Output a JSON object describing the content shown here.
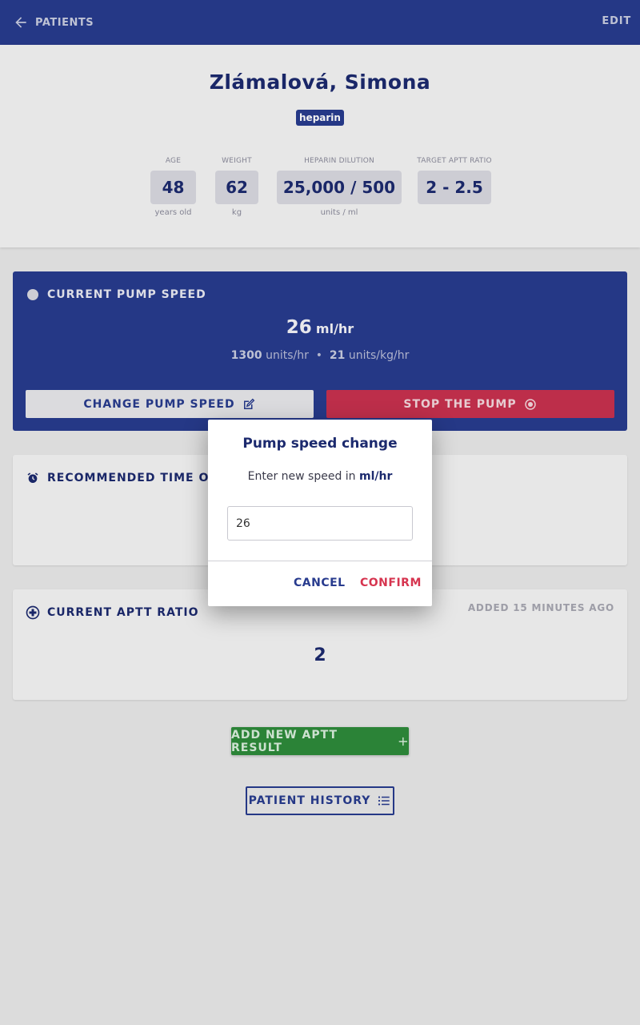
{
  "topbar": {
    "back_label": "PATIENTS",
    "edit_label": "EDIT"
  },
  "patient": {
    "name": "Zlámalová, Simona",
    "tag": "heparin",
    "stats": [
      {
        "label": "AGE",
        "value": "48",
        "unit": "years old"
      },
      {
        "label": "WEIGHT",
        "value": "62",
        "unit": "kg"
      },
      {
        "label": "HEPARIN DILUTION",
        "value": "25,000 / 500",
        "unit": "units / ml"
      },
      {
        "label": "TARGET APTT RATIO",
        "value": "2 - 2.5",
        "unit": ""
      }
    ]
  },
  "pump": {
    "title": "CURRENT PUMP SPEED",
    "speed": "26",
    "speed_unit": "ml/hr",
    "units_hr_value": "1300",
    "units_hr_label": "units/hr",
    "separator": "•",
    "units_kg_hr_value": "21",
    "units_kg_hr_label": "units/kg/hr",
    "change_label": "CHANGE PUMP SPEED",
    "stop_label": "STOP THE PUMP"
  },
  "recommended": {
    "title": "RECOMMENDED TIME OF N"
  },
  "aptt": {
    "title": "CURRENT APTT RATIO",
    "added": "ADDED 15 MINUTES AGO",
    "value": "2"
  },
  "actions": {
    "add_label": "ADD NEW APTT RESULT",
    "history_label": "PATIENT HISTORY"
  },
  "dialog": {
    "title": "Pump speed change",
    "text_prefix": "Enter new speed in",
    "text_unit": "ml/hr",
    "input_value": "26",
    "cancel_label": "CANCEL",
    "confirm_label": "CONFIRM"
  },
  "colors": {
    "primary": "#283b8e",
    "danger": "#c8314e",
    "success": "#2e8b3a"
  },
  "icons": [
    "arrow-left-icon",
    "edit-square-icon",
    "radio-stop-icon",
    "alarm-clock-icon",
    "plus-circle-icon",
    "plus-icon",
    "list-icon"
  ]
}
